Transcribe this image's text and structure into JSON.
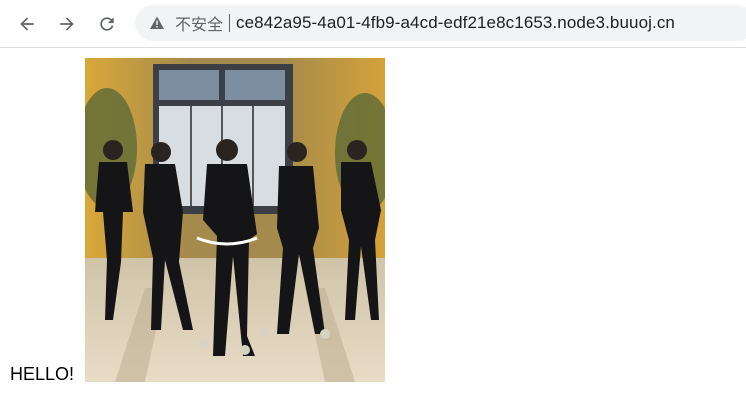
{
  "browser": {
    "security_label": "不安全",
    "url": "ce842a95-4a01-4fb9-a4cd-edf21e8c1653.node3.buuoj.cn",
    "icons": [
      "back-icon",
      "forward-icon",
      "reload-icon",
      "warning-icon"
    ]
  },
  "page": {
    "greeting": "HELLO!"
  },
  "colors": {
    "toolbar_bg": "#ffffff",
    "omnibox_bg": "#f1f3f4",
    "icon": "#5f6368"
  }
}
